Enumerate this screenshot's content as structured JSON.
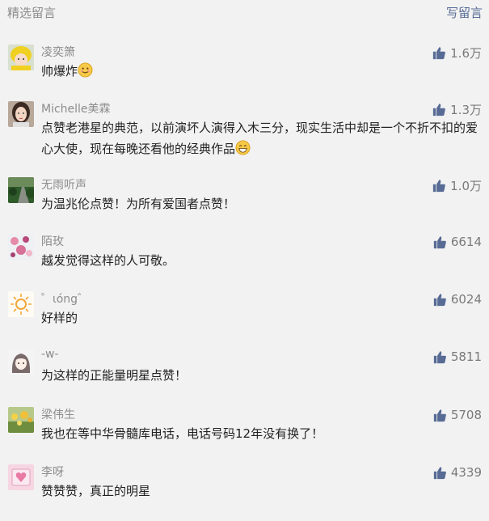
{
  "header": {
    "title": "精选留言",
    "write_label": "写留言"
  },
  "colors": {
    "background": "#f2f2f2",
    "link": "#576b95",
    "muted": "#8c8c8c",
    "like_icon": "#576b95"
  },
  "comments": [
    {
      "name": "凌奕箫",
      "text": "帅爆炸",
      "emoji": "smile-emoji",
      "likes": "1.6万",
      "avatar_icon": "avatar-yellow-hat-child"
    },
    {
      "name": "Michelle美霖",
      "text": "点赞老港星的典范，以前演坏人演得入木三分，现实生活中却是一个不折不扣的爱心大使，现在每晚还看他的经典作品",
      "emoji": "grin-emoji",
      "likes": "1.3万",
      "avatar_icon": "avatar-woman-portrait"
    },
    {
      "name": "无雨听声",
      "text": "为温兆伦点赞！为所有爱国者点赞！",
      "emoji": "",
      "likes": "1.0万",
      "avatar_icon": "avatar-green-path"
    },
    {
      "name": "陌玫",
      "text": "越发觉得这样的人可敬。",
      "emoji": "",
      "likes": "6614",
      "avatar_icon": "avatar-pink-blossoms"
    },
    {
      "name": "゜ιόng゛",
      "text": "好样的",
      "emoji": "",
      "likes": "6024",
      "avatar_icon": "avatar-sun-drawing"
    },
    {
      "name": "-w-",
      "text": "为这样的正能量明星点赞！",
      "emoji": "",
      "likes": "5811",
      "avatar_icon": "avatar-cartoon-girl"
    },
    {
      "name": "梁伟生",
      "text": "我也在等中华骨髓库电话，电话号码12年没有换了！",
      "emoji": "",
      "likes": "5708",
      "avatar_icon": "avatar-flower-field"
    },
    {
      "name": "李呀",
      "text": "赞赞赞，真正的明星",
      "emoji": "",
      "likes": "4339",
      "avatar_icon": "avatar-pink-card"
    }
  ]
}
